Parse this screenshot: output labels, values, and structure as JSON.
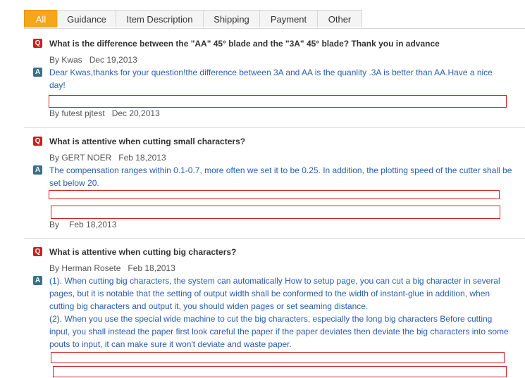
{
  "tabs": [
    {
      "label": "All",
      "active": true
    },
    {
      "label": "Guidance",
      "active": false
    },
    {
      "label": "Item Description",
      "active": false
    },
    {
      "label": "Shipping",
      "active": false
    },
    {
      "label": "Payment",
      "active": false
    },
    {
      "label": "Other",
      "active": false
    }
  ],
  "badges": {
    "q": "Q",
    "a": "A"
  },
  "qas": [
    {
      "question": "What is the difference between the \"AA\" 45° blade and the \"3A\" 45° blade? Thank you in advance",
      "asker": "By Kwas",
      "asked_date": "Dec 19,2013",
      "answer": "Dear Kwas,thanks for your question!the difference between 3A and AA is the quanlity .3A is better than AA.Have a nice day!",
      "answerer": "By futest pjtest",
      "answer_date": "Dec 20,2013"
    },
    {
      "question": "What is attentive when cutting small characters?",
      "asker": "By GERT NOER",
      "asked_date": "Feb 18,2013",
      "answer": "The compensation ranges within 0.1-0.7, more often we set it to be 0.25. In addition, the plotting speed of the cutter shall be set below 20.",
      "answerer": "By",
      "answer_date": "Feb 18,2013"
    },
    {
      "question": "What is attentive when cutting big characters?",
      "asker": "By Herman Rosete",
      "asked_date": "Feb 18,2013",
      "answer": "(1). When cutting big characters, the system can automatically How to setup page, you can cut a big character in several pages, but it is notable that the setting of output width shall be conformed to the width of instant-glue in addition, when cutting big characters and output it, you should widen pages or set seaming distance.",
      "answer2": "(2). When you use the special wide machine to cut the big characters, especially the long big characters Before cutting input, you shall instead the paper first look careful the paper if the paper deviates then deviate the big characters into some pouts to input, it can make sure it won't deviate and waste paper."
    }
  ],
  "colors": {
    "accent": "#f7a51a",
    "q_badge": "#cc1f1f",
    "a_badge": "#3d6e86",
    "answer_text": "#2a5db0",
    "outline": "#cc2222"
  }
}
